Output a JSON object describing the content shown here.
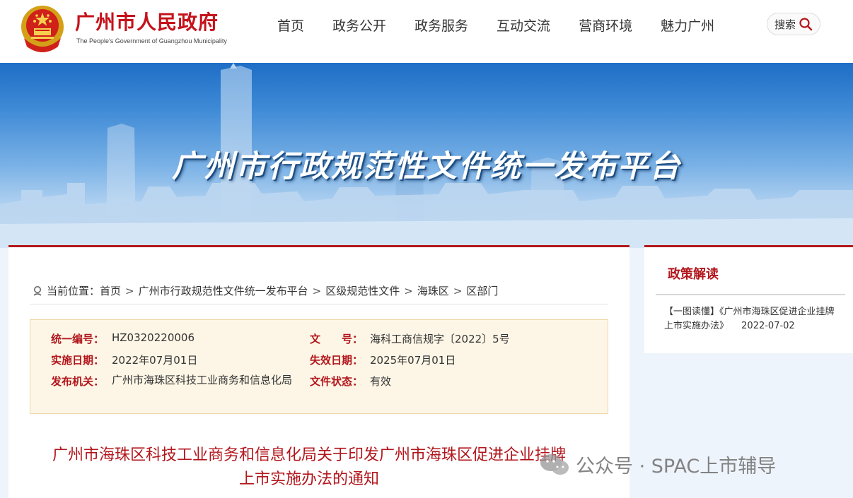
{
  "header": {
    "brand_cn": "广州市人民政府",
    "brand_en": "The People's Government of Guangzhou Municipality",
    "nav": [
      "首页",
      "政务公开",
      "政务服务",
      "互动交流",
      "营商环境",
      "魅力广州"
    ],
    "search_label": "搜索"
  },
  "banner": {
    "title": "广州市行政规范性文件统一发布平台"
  },
  "breadcrumb": {
    "prefix": "当前位置：",
    "items": [
      "首页",
      "广州市行政规范性文件统一发布平台",
      "区级规范性文件",
      "海珠区",
      "区部门"
    ],
    "separator": ">"
  },
  "doc_info": {
    "serial_label": "统一编号：",
    "serial_value": "HZ0320220006",
    "doc_no_label": "文　　号：",
    "doc_no_value": "海科工商信规字〔2022〕5号",
    "effective_label": "实施日期：",
    "effective_value": "2022年07月01日",
    "expiry_label": "失效日期：",
    "expiry_value": "2025年07月01日",
    "issuer_label": "发布机关：",
    "issuer_value": "广州市海珠区科技工业商务和信息化局",
    "status_label": "文件状态：",
    "status_value": "有效"
  },
  "document": {
    "title": "广州市海珠区科技工业商务和信息化局关于印发广州市海珠区促进企业挂牌上市实施办法的通知"
  },
  "side": {
    "title": "政策解读",
    "link_text": "【一图读懂】《广州市海珠区促进企业挂牌上市实施办法》",
    "link_date": "2022-07-02"
  },
  "watermark": {
    "text": "公众号 · SPAC上市辅导"
  },
  "colors": {
    "brand_red": "#c5121b",
    "accent_red": "#b2161c",
    "info_bg": "#fdf6e6"
  }
}
